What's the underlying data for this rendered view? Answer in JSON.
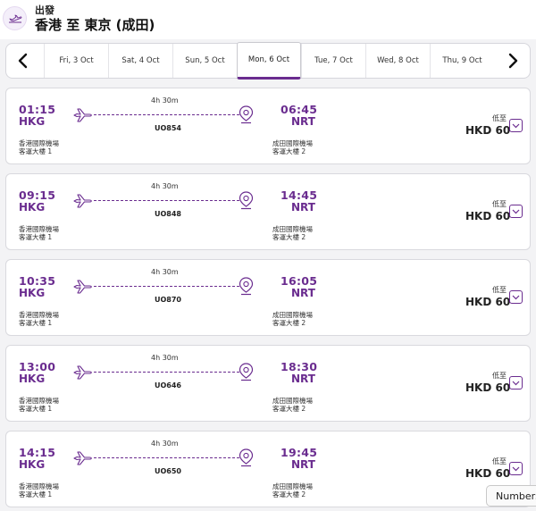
{
  "header": {
    "label": "出發",
    "title": "香港 至 東京 (成田)"
  },
  "dates": [
    {
      "label": "Fri, 3 Oct",
      "active": false
    },
    {
      "label": "Sat, 4 Oct",
      "active": false
    },
    {
      "label": "Sun, 5 Oct",
      "active": false
    },
    {
      "label": "Mon, 6 Oct",
      "active": true
    },
    {
      "label": "Tue, 7 Oct",
      "active": false
    },
    {
      "label": "Wed, 8 Oct",
      "active": false
    },
    {
      "label": "Thu, 9 Oct",
      "active": false
    }
  ],
  "flights": [
    {
      "dep_time": "01:15",
      "dep_code": "HKG",
      "arr_time": "06:45",
      "arr_code": "NRT",
      "duration": "4h 30m",
      "flight_no": "UO854",
      "dep_airport": "香港國際機場",
      "dep_terminal": "客運大樓 1",
      "arr_airport": "成田國際機場",
      "arr_terminal": "客運大樓 2",
      "price_label": "低至",
      "price": "HKD 60"
    },
    {
      "dep_time": "09:15",
      "dep_code": "HKG",
      "arr_time": "14:45",
      "arr_code": "NRT",
      "duration": "4h 30m",
      "flight_no": "UO848",
      "dep_airport": "香港國際機場",
      "dep_terminal": "客運大樓 1",
      "arr_airport": "成田國際機場",
      "arr_terminal": "客運大樓 2",
      "price_label": "低至",
      "price": "HKD 60"
    },
    {
      "dep_time": "10:35",
      "dep_code": "HKG",
      "arr_time": "16:05",
      "arr_code": "NRT",
      "duration": "4h 30m",
      "flight_no": "UO870",
      "dep_airport": "香港國際機場",
      "dep_terminal": "客運大樓 1",
      "arr_airport": "成田國際機場",
      "arr_terminal": "客運大樓 2",
      "price_label": "低至",
      "price": "HKD 60"
    },
    {
      "dep_time": "13:00",
      "dep_code": "HKG",
      "arr_time": "18:30",
      "arr_code": "NRT",
      "duration": "4h 30m",
      "flight_no": "UO646",
      "dep_airport": "香港國際機場",
      "dep_terminal": "客運大樓 1",
      "arr_airport": "成田國際機場",
      "arr_terminal": "客運大樓 2",
      "price_label": "低至",
      "price": "HKD 60"
    },
    {
      "dep_time": "14:15",
      "dep_code": "HKG",
      "arr_time": "19:45",
      "arr_code": "NRT",
      "duration": "4h 30m",
      "flight_no": "UO650",
      "dep_airport": "香港國際機場",
      "dep_terminal": "客運大樓 1",
      "arr_airport": "成田國際機場",
      "arr_terminal": "客運大樓 2",
      "price_label": "低至",
      "price": "HKD 60"
    }
  ],
  "tooltip": "Numbers",
  "icons": {
    "header": "plane-departure-icon",
    "prev": "chevron-left-icon",
    "next": "chevron-right-icon",
    "departure": "plane-icon",
    "arrival": "location-pin-icon",
    "expand": "chevron-down-icon"
  },
  "colors": {
    "accent": "#6a2c8f",
    "background": "#f3f3f5"
  }
}
